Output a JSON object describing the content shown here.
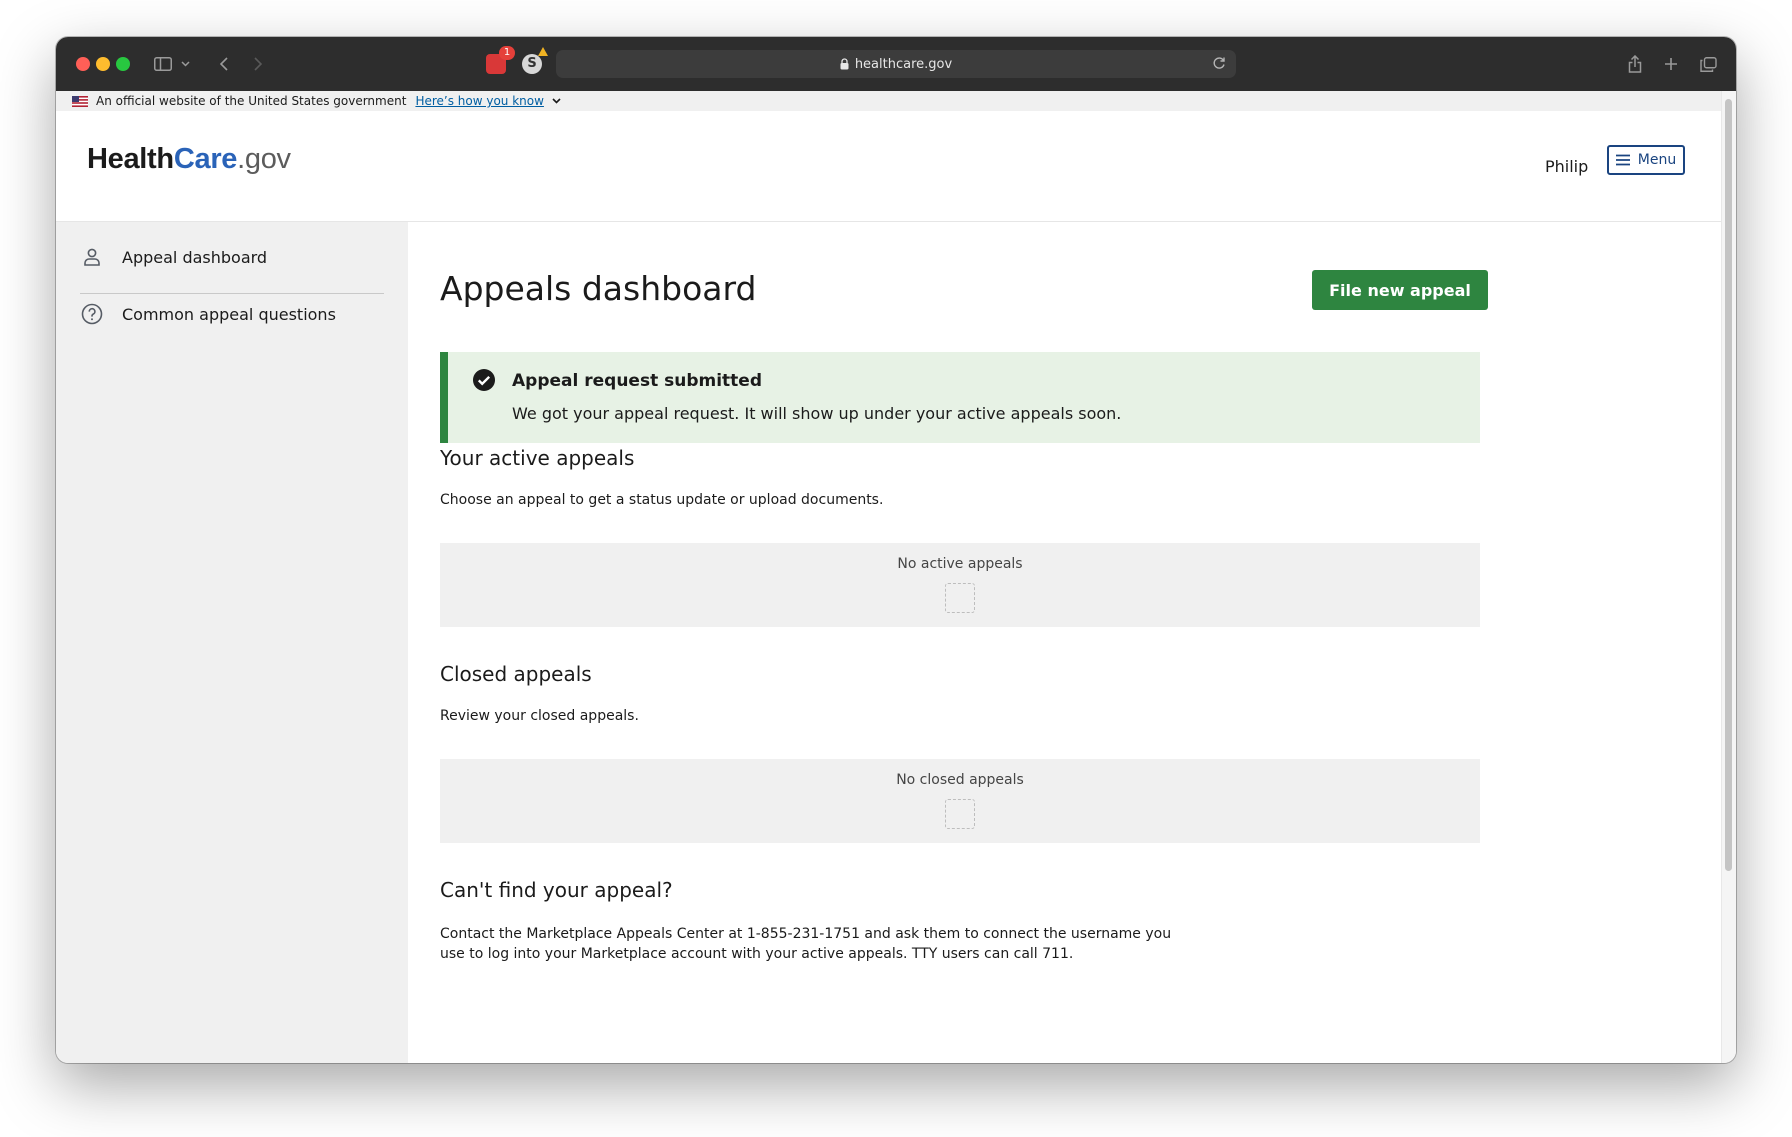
{
  "browser": {
    "url": "healthcare.gov",
    "extension_badge": "1",
    "extension_s_letter": "S"
  },
  "gov_banner": {
    "text": "An official website of the United States government",
    "link": "Here’s how you know"
  },
  "header": {
    "logo_part1": "Health",
    "logo_part2": "Care",
    "logo_part3": ".gov",
    "user_name": "Philip",
    "menu_label": "Menu"
  },
  "sidebar": {
    "items": [
      {
        "label": "Appeal dashboard",
        "icon": "person-icon"
      },
      {
        "label": "Common appeal questions",
        "icon": "question-circle-icon"
      }
    ]
  },
  "main": {
    "title": "Appeals dashboard",
    "new_appeal_button": "File new appeal",
    "alert": {
      "title": "Appeal request submitted",
      "body": "We got your appeal request. It will show up under your active appeals soon."
    },
    "active": {
      "heading": "Your active appeals",
      "description": "Choose an appeal to get a status update or upload documents.",
      "empty_label": "No active appeals"
    },
    "closed": {
      "heading": "Closed appeals",
      "description": "Review your closed appeals.",
      "empty_label": "No closed appeals"
    },
    "help": {
      "heading": "Can't find your appeal?",
      "body": "Contact the Marketplace Appeals Center at 1-855-231-1751 and ask them to connect the username you use to log into your Marketplace account with your active appeals. TTY users can call 711."
    }
  },
  "colors": {
    "primary_green": "#2e8540",
    "alert_background": "#e7f2e5",
    "brand_blue": "#2a63b8",
    "menu_border": "#1a4480"
  }
}
